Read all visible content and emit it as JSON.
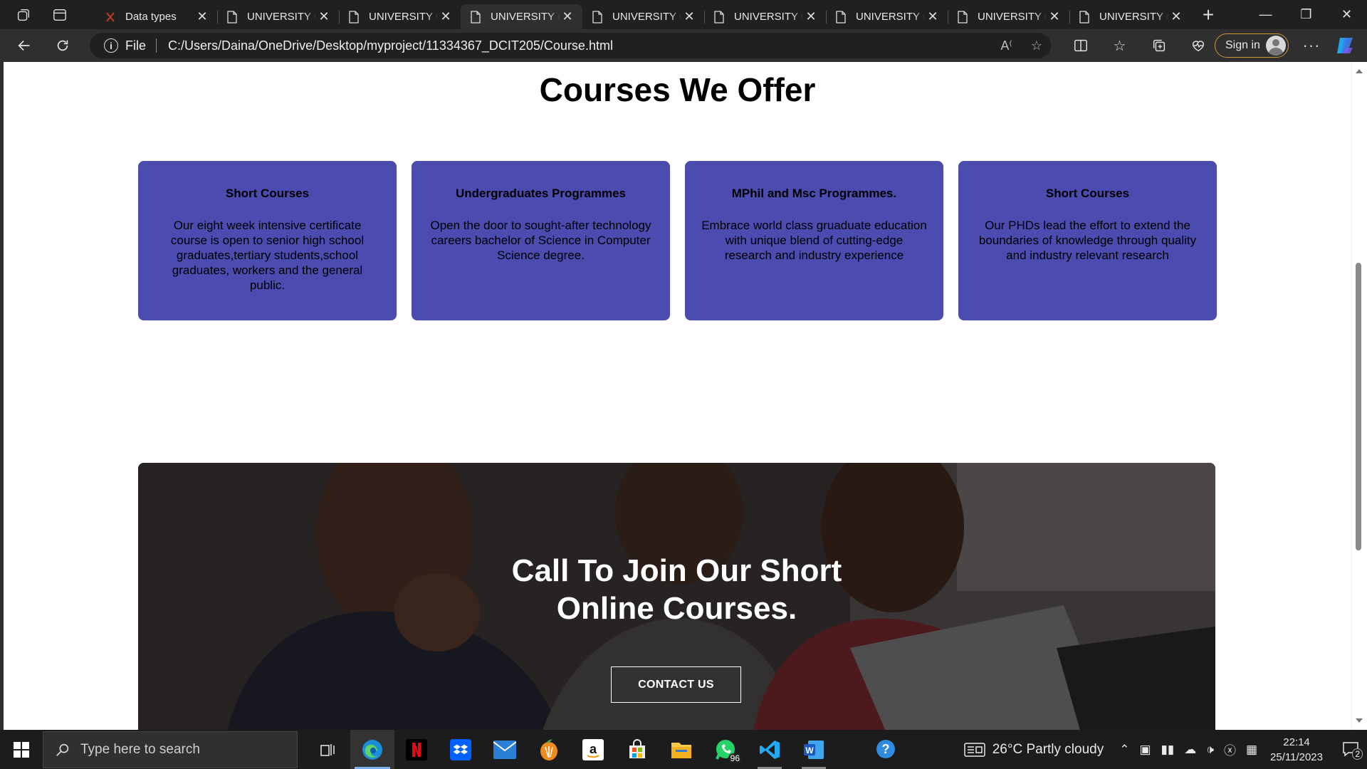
{
  "browser": {
    "tabs": [
      {
        "title": "Data types",
        "icon": "pdf-icon",
        "active": false
      },
      {
        "title": "UNIVERSITY OF",
        "icon": "page-icon",
        "active": false
      },
      {
        "title": "UNIVERSITY OF",
        "icon": "page-icon",
        "active": false
      },
      {
        "title": "UNIVERSITY OF",
        "icon": "page-icon",
        "active": true
      },
      {
        "title": "UNIVERSITY OF",
        "icon": "page-icon",
        "active": false
      },
      {
        "title": "UNIVERSITY OF",
        "icon": "page-icon",
        "active": false
      },
      {
        "title": "UNIVERSITY OF",
        "icon": "page-icon",
        "active": false
      },
      {
        "title": "UNIVERSITY OF",
        "icon": "page-icon",
        "active": false
      },
      {
        "title": "UNIVERSITY OF",
        "icon": "page-icon",
        "active": false
      }
    ],
    "address": {
      "scheme_label": "File",
      "url": "C:/Users/Daina/OneDrive/Desktop/myproject/11334367_DCIT205/Course.html"
    },
    "sign_in_label": "Sign in"
  },
  "page": {
    "title": "Courses We Offer",
    "cards": [
      {
        "title": "Short Courses",
        "body": "Our eight week intensive certificate course is open to senior high school graduates,tertiary students,school graduates, workers and the general public."
      },
      {
        "title": "Undergraduates Programmes",
        "body": "Open the door to sought-after technology careers bachelor of Science in Computer Science degree."
      },
      {
        "title": "MPhil and Msc Programmes.",
        "body": "Embrace world class gruaduate education with unique blend of cutting-edge research and industry experience"
      },
      {
        "title": "Short Courses",
        "body": "Our PHDs lead the effort to extend the boundaries of knowledge through quality and industry relevant research"
      }
    ],
    "banner": {
      "heading_line1": "Call To Join Our Short",
      "heading_line2": "Online Courses.",
      "button_label": "CONTACT US"
    },
    "colors": {
      "card_bg": "#4c4cb0",
      "banner_overlay": "rgba(0,0,0,0.45)"
    }
  },
  "taskbar": {
    "search_placeholder": "Type here to search",
    "apps": [
      "task-view-icon",
      "edge-icon",
      "netflix-icon",
      "dropbox-icon",
      "mail-icon",
      "fl-studio-icon",
      "amazon-icon",
      "store-icon",
      "file-explorer-icon",
      "whatsapp-icon",
      "vscode-icon",
      "word-icon",
      "help-icon"
    ],
    "whatsapp_badge": "96",
    "weather": "26°C  Partly cloudy",
    "time": "22:14",
    "date": "25/11/2023",
    "notification_count": "2"
  }
}
